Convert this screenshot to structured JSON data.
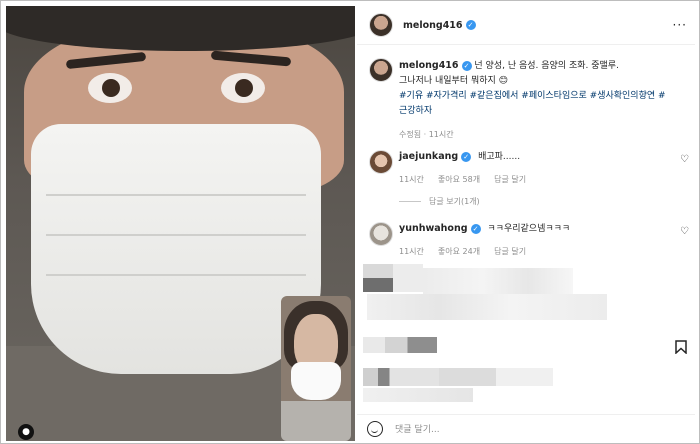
{
  "post": {
    "username": "melong416",
    "caption_user": "melong416",
    "caption_text": "넌 양성, 난 음성. 음양의 조화. 중맬루.",
    "caption_line2": "그나저나 내일부터 뭐하지 😊",
    "hashtags_line1": "#기유 #자가격리 #같은집에서 #페이스타임으로 #생사확인의향연 #",
    "hashtags_line2": "근강하자",
    "caption_meta": "수정됨 · 11시간"
  },
  "comments": [
    {
      "user": "jaejunkang",
      "text": "배고파......",
      "time": "11시간",
      "likes": "좋아요 58개",
      "reply": "답글 달기"
    },
    {
      "user": "yunhwahong",
      "text": "ㅋㅋ우리같으넴ㅋㅋㅋ",
      "time": "11시간",
      "likes": "좋아요 24개",
      "reply": "답글 달기"
    }
  ],
  "reply_toggle": "답글 보기(1개)",
  "footer": {
    "placeholder": "댓글 달기..."
  },
  "icons": {
    "verified": "verified-badge-icon",
    "more": "more-options-icon",
    "heart": "heart-icon",
    "bookmark": "bookmark-icon",
    "emoji": "emoji-icon"
  },
  "colors": {
    "verified": "#3897f0",
    "hashtag": "#00376b",
    "meta": "#8e8e8e"
  }
}
